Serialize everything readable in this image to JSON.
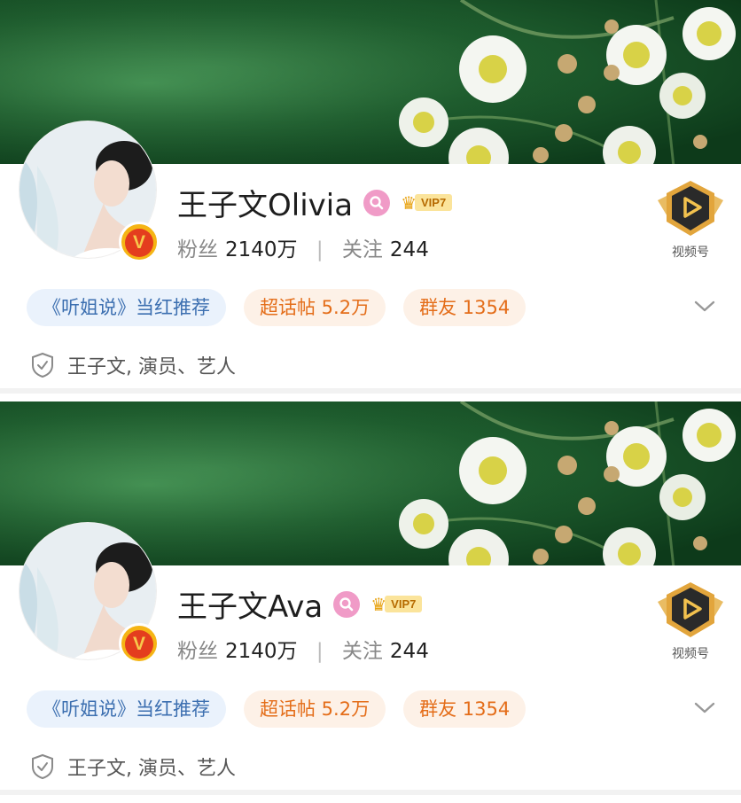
{
  "profiles": [
    {
      "name": "王子文Olivia",
      "vip": "VIP7",
      "fans_label": "粉丝",
      "fans_value": "2140万",
      "follow_label": "关注",
      "follow_value": "244",
      "video_label": "视频号",
      "chips": [
        "《听姐说》当红推荐",
        "超话帖 5.2万",
        "群友 1354"
      ],
      "verification": "王子文, 演员、艺人"
    },
    {
      "name": "王子文Ava",
      "vip": "VIP7",
      "fans_label": "粉丝",
      "fans_value": "2140万",
      "follow_label": "关注",
      "follow_value": "244",
      "video_label": "视频号",
      "chips": [
        "《听姐说》当红推荐",
        "超话帖 5.2万",
        "群友 1354"
      ],
      "verification": "王子文, 演员、艺人"
    }
  ],
  "icons": {
    "verified_badge": "V",
    "search_badge": "search-icon",
    "vip_crown": "crown-icon",
    "video_channel": "video-channel-icon",
    "expand": "chevron-down-icon",
    "verify_shield": "shield-check-icon"
  },
  "colors": {
    "chip_blue_bg": "#eaf2fc",
    "chip_blue_text": "#3c6fb0",
    "chip_orange_bg": "#fdf1e7",
    "chip_orange_text": "#e46d19",
    "badge_pink": "#f09bc7",
    "vip_gold": "#e8a312"
  }
}
